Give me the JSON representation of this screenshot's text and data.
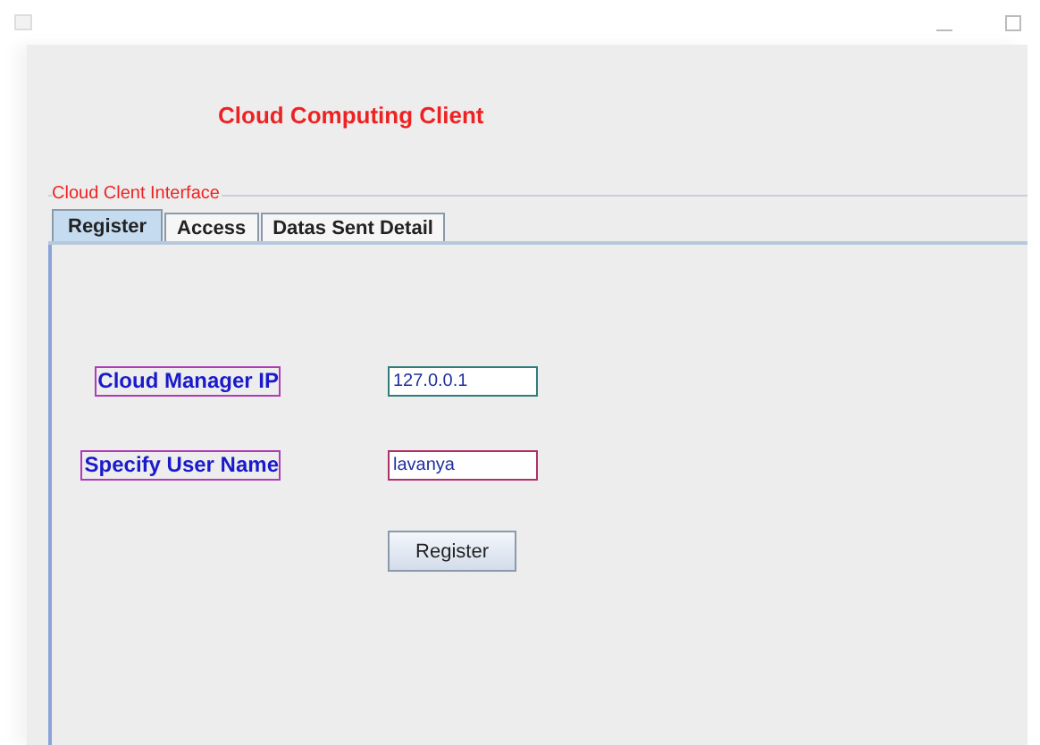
{
  "window": {
    "heading": "Cloud Computing Client"
  },
  "group": {
    "legend": "Cloud Clent Interface"
  },
  "tabs": [
    {
      "label": "Register",
      "selected": true
    },
    {
      "label": "Access",
      "selected": false
    },
    {
      "label": "Datas Sent Detail",
      "selected": false
    }
  ],
  "form": {
    "fields": [
      {
        "label": "Cloud Manager IP",
        "value": "127.0.0.1",
        "color": "#2e7d7d"
      },
      {
        "label": "Specify User Name",
        "value": "lavanya",
        "color": "#b0306a"
      }
    ],
    "button": "Register"
  }
}
